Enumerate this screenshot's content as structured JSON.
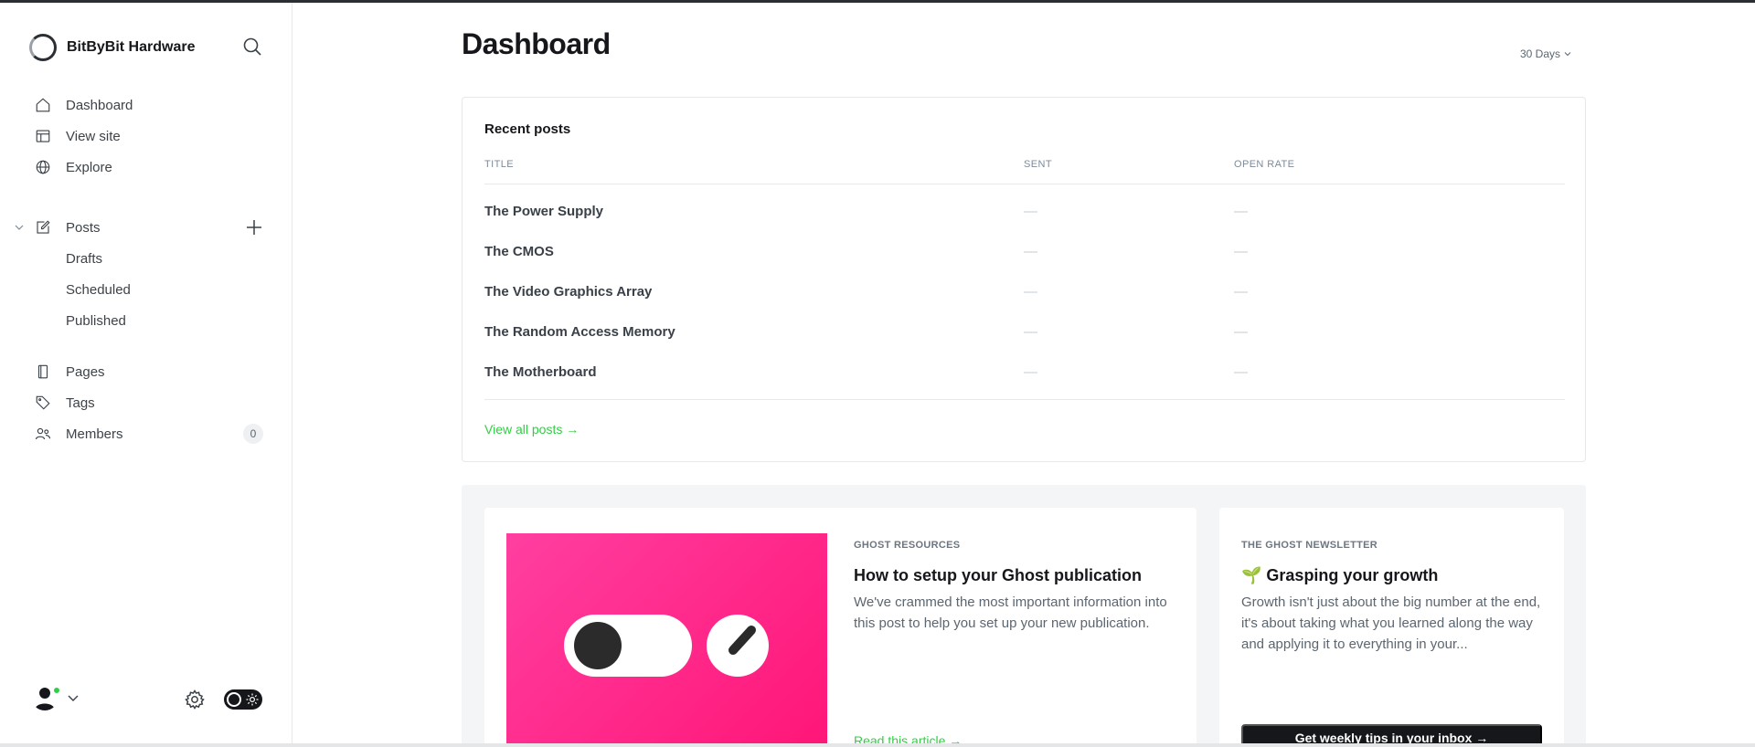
{
  "brand": {
    "name": "BitByBit Hardware"
  },
  "sidebar": {
    "nav": [
      {
        "label": "Dashboard",
        "icon": "home-icon"
      },
      {
        "label": "View site",
        "icon": "layout-icon"
      },
      {
        "label": "Explore",
        "icon": "globe-icon"
      }
    ],
    "posts": {
      "label": "Posts",
      "sub": [
        "Drafts",
        "Scheduled",
        "Published"
      ]
    },
    "more": [
      {
        "label": "Pages",
        "icon": "page-icon"
      },
      {
        "label": "Tags",
        "icon": "tag-icon"
      },
      {
        "label": "Members",
        "icon": "members-icon",
        "badge": "0"
      }
    ]
  },
  "main": {
    "title": "Dashboard",
    "range": "30 Days",
    "recent_posts": {
      "title": "Recent posts",
      "columns": [
        "TITLE",
        "SENT",
        "OPEN RATE"
      ],
      "rows": [
        {
          "title": "The Power Supply",
          "sent": "—",
          "open_rate": "—"
        },
        {
          "title": "The CMOS",
          "sent": "—",
          "open_rate": "—"
        },
        {
          "title": "The Video Graphics Array",
          "sent": "—",
          "open_rate": "—"
        },
        {
          "title": "The Random Access Memory",
          "sent": "—",
          "open_rate": "—"
        },
        {
          "title": "The Motherboard",
          "sent": "—",
          "open_rate": "—"
        }
      ],
      "view_all": "View all posts →"
    },
    "resources": {
      "eyebrow": "GHOST RESOURCES",
      "title": "How to setup your Ghost publication",
      "text": "We've crammed the most important information into this post to help you set up your new publication.",
      "link": "Read this article →"
    },
    "newsletter": {
      "eyebrow": "THE GHOST NEWSLETTER",
      "title": "🌱 Grasping your growth",
      "text": "Growth isn't just about the big number at the end, it's about taking what you learned along the way and applying it to everything in your...",
      "cta": "Get weekly tips in your inbox →"
    }
  },
  "colors": {
    "accent": "#30cf43",
    "pink": "#ff1678",
    "dark": "#15171a"
  }
}
